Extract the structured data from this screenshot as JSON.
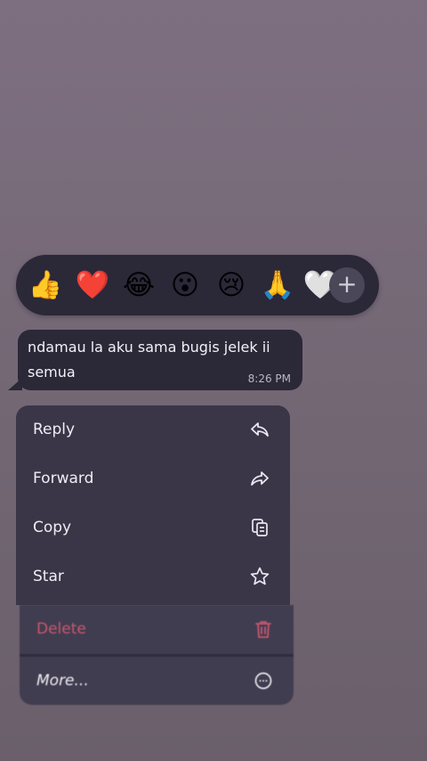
{
  "reactions": {
    "emojis": [
      {
        "name": "thumbs-up-emoji",
        "char": "👍"
      },
      {
        "name": "heart-emoji",
        "char": "❤️"
      },
      {
        "name": "laughing-emoji",
        "char": "😂"
      },
      {
        "name": "surprised-emoji",
        "char": "😮"
      },
      {
        "name": "crying-emoji",
        "char": "😢"
      },
      {
        "name": "praying-hands-emoji",
        "char": "🙏"
      },
      {
        "name": "white-heart-emoji",
        "char": "🤍"
      }
    ],
    "more_label": "+"
  },
  "message": {
    "text": "ndamau la aku sama bugis jelek ii semua",
    "time": "8:26 PM"
  },
  "menu": {
    "reply": "Reply",
    "forward": "Forward",
    "copy": "Copy",
    "star": "Star",
    "delete": "Delete",
    "more": "More..."
  },
  "colors": {
    "delete": "#c8566e",
    "bubble": "#2b2838",
    "menu": "#3a3648"
  }
}
